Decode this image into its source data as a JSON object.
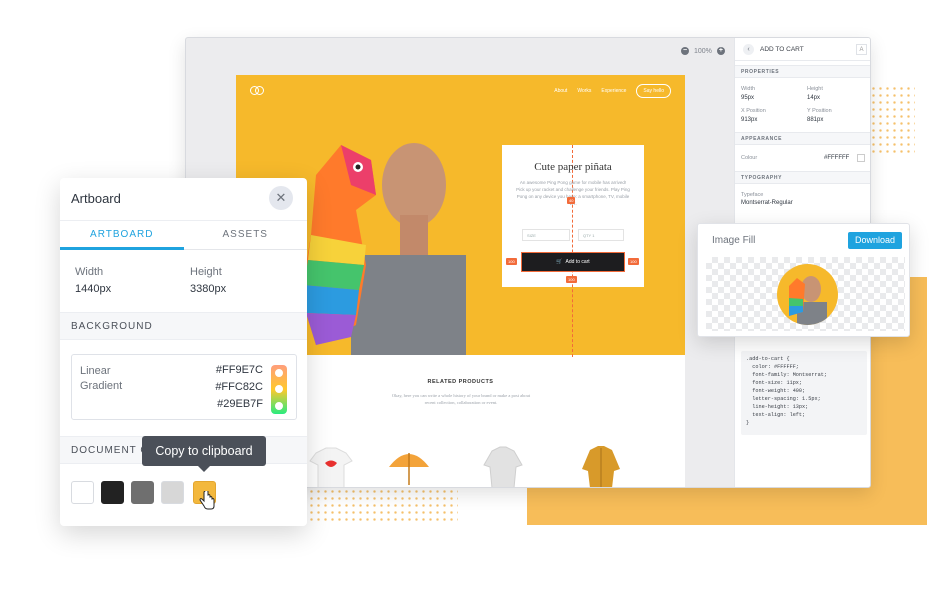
{
  "window": {
    "zoom_level": "100%",
    "zoom_out": "−",
    "zoom_in": "+"
  },
  "site": {
    "nav": [
      "About",
      "Works",
      "Experience"
    ],
    "cta": "Say hello",
    "product_title": "Cute paper piñata",
    "product_description": "An awesome Ping Pong game for mobile has arrived! Pick up your racket and challenge your friends. Play Ping Pong on any device you have: a smartphone, TV, mobile VR.",
    "size_select": "SIZE",
    "qty_select": "QTY 1",
    "add_to_cart": "Add to cart",
    "guide_top": "40",
    "guide_left": "100",
    "guide_right": "100",
    "guide_bottom": "100",
    "related_title": "RELATED PRODUCTS",
    "related_body": "Okay, here you can write a whole history of your brand or make a post about recent collection, collaboration or event."
  },
  "inspector": {
    "title": "ADD TO CART",
    "back_icon": "chevron-left-icon",
    "text_icon": "A",
    "properties_header": "PROPERTIES",
    "width_label": "Width",
    "width_value": "95px",
    "height_label": "Height",
    "height_value": "14px",
    "x_label": "X Position",
    "x_value": "913px",
    "y_label": "Y Position",
    "y_value": "881px",
    "appearance_header": "APPEARANCE",
    "colour_label": "Colour",
    "colour_value": "#FFFFFF",
    "typography_header": "TYPOGRAPHY",
    "typeface_label": "Typeface",
    "typeface_value": "Montserrat-Regular",
    "css_code": ".add-to-cart {\n  color: #FFFFFF;\n  font-family: Montserrat;\n  font-size: 11px;\n  font-weight: 400;\n  letter-spacing: 1.5px;\n  line-height: 13px;\n  text-align: left;\n}"
  },
  "image_fill": {
    "title": "Image Fill",
    "download": "Download"
  },
  "artboard": {
    "title": "Artboard",
    "close_icon": "close-icon",
    "tabs": [
      "ARTBOARD",
      "ASSETS"
    ],
    "width_label": "Width",
    "width_value": "1440px",
    "height_label": "Height",
    "height_value": "3380px",
    "background_header": "BACKGROUND",
    "gradient_type_1": "Linear",
    "gradient_type_2": "Gradient",
    "stops": [
      "#FF9E7C",
      "#FFC82C",
      "#29EB7F"
    ],
    "doc_colors_header": "DOCUMENT COLORS",
    "swatches": [
      "#ffffff",
      "#222222",
      "#6f6f6f",
      "#d7d7d7",
      "#f3b83d"
    ],
    "tooltip": "Copy to clipboard"
  }
}
